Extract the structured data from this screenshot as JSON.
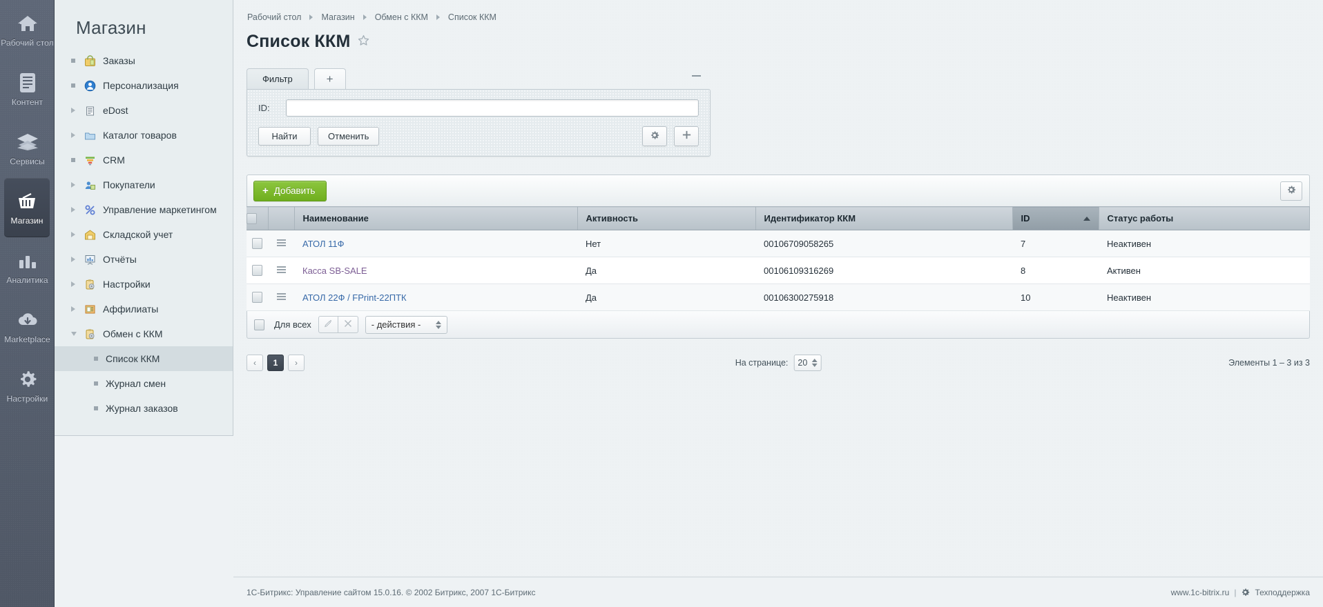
{
  "rail": {
    "items": [
      {
        "label": "Рабочий стол",
        "icon": "home-icon",
        "active": false
      },
      {
        "label": "Контент",
        "icon": "document-icon",
        "active": false
      },
      {
        "label": "Сервисы",
        "icon": "layers-icon",
        "active": false
      },
      {
        "label": "Магазин",
        "icon": "basket-icon",
        "active": true
      },
      {
        "label": "Аналитика",
        "icon": "bar-chart-icon",
        "active": false
      },
      {
        "label": "Marketplace",
        "icon": "cloud-download-icon",
        "active": false
      },
      {
        "label": "Настройки",
        "icon": "gear-icon",
        "active": false
      }
    ]
  },
  "sidebar": {
    "title": "Магазин",
    "items": [
      {
        "label": "Заказы",
        "marker": "square",
        "icon": "orders-icon"
      },
      {
        "label": "Персонализация",
        "marker": "square",
        "icon": "personalization-icon"
      },
      {
        "label": "eDost",
        "marker": "triangle",
        "icon": "edost-icon"
      },
      {
        "label": "Каталог товаров",
        "marker": "triangle",
        "icon": "folder-icon"
      },
      {
        "label": "CRM",
        "marker": "square",
        "icon": "crm-funnel-icon"
      },
      {
        "label": "Покупатели",
        "marker": "triangle",
        "icon": "customers-icon"
      },
      {
        "label": "Управление маркетингом",
        "marker": "triangle",
        "icon": "percent-icon"
      },
      {
        "label": "Складской учет",
        "marker": "triangle",
        "icon": "warehouse-icon"
      },
      {
        "label": "Отчёты",
        "marker": "triangle",
        "icon": "reports-icon"
      },
      {
        "label": "Настройки",
        "marker": "triangle",
        "icon": "settings-clipboard-icon"
      },
      {
        "label": "Аффилиаты",
        "marker": "triangle",
        "icon": "affiliates-icon"
      },
      {
        "label": "Обмен с ККМ",
        "marker": "triangle-down",
        "icon": "kkm-exchange-icon"
      }
    ],
    "subitems": [
      {
        "label": "Список ККМ",
        "selected": true
      },
      {
        "label": "Журнал смен",
        "selected": false
      },
      {
        "label": "Журнал заказов",
        "selected": false
      }
    ]
  },
  "breadcrumb": {
    "items": [
      "Рабочий стол",
      "Магазин",
      "Обмен с ККМ",
      "Список ККМ"
    ]
  },
  "page": {
    "title": "Список ККМ",
    "favorite_icon": "star-outline-icon"
  },
  "filter": {
    "tab_label": "Фильтр",
    "add_tab_label": "+",
    "collapse_label": "—",
    "id_label": "ID:",
    "id_value": "",
    "id_placeholder": "",
    "search_label": "Найти",
    "cancel_label": "Отменить",
    "settings_icon": "gear-icon",
    "add_icon": "plus-icon"
  },
  "toolbar": {
    "add_label": "Добавить",
    "add_plus": "+",
    "settings_icon": "gear-icon"
  },
  "grid": {
    "columns": [
      {
        "key": "check",
        "label": ""
      },
      {
        "key": "menu",
        "label": ""
      },
      {
        "key": "name",
        "label": "Наименование"
      },
      {
        "key": "activity",
        "label": "Активность"
      },
      {
        "key": "kkm_id",
        "label": "Идентификатор ККМ"
      },
      {
        "key": "id",
        "label": "ID",
        "sorted": true,
        "sort_dir": "asc"
      },
      {
        "key": "status",
        "label": "Статус работы"
      }
    ],
    "rows": [
      {
        "name": "АТОЛ 11Ф",
        "visited": false,
        "activity": "Нет",
        "kkm_id": "00106709058265",
        "id": "7",
        "status": "Неактивен"
      },
      {
        "name": "Касса SB-SALE",
        "visited": true,
        "activity": "Да",
        "kkm_id": "00106109316269",
        "id": "8",
        "status": "Активен"
      },
      {
        "name": "АТОЛ 22Ф / FPrint-22ПТК",
        "visited": false,
        "activity": "Да",
        "kkm_id": "00106300275918",
        "id": "10",
        "status": "Неактивен"
      }
    ]
  },
  "group_actions": {
    "select_all_label": "Для всех",
    "edit_icon": "pencil-icon",
    "delete_icon": "close-x-icon",
    "action_select_value": "- действия -"
  },
  "pager": {
    "prev_label": "‹",
    "next_label": "›",
    "pages": [
      "1"
    ],
    "current_page": "1",
    "per_page_label": "На странице:",
    "per_page_value": "20",
    "count_text": "Элементы 1 – 3 из 3"
  },
  "footer": {
    "copyright": "1С-Битрикс: Управление сайтом 15.0.16. © 2002 Битрикс, 2007 1С-Битрикс",
    "site_link": "www.1c-bitrix.ru",
    "separator": "|",
    "support_link": "Техподдержка",
    "support_icon": "gear-icon"
  },
  "colors": {
    "rail_bg": "#565f6e",
    "sidebar_bg": "#e8eef0",
    "workarea_bg": "#eef2f4",
    "add_button_green": "#7cb82f",
    "link_blue": "#3769a8",
    "link_visited": "#7c5d94",
    "header_grey": "#b8c2c9",
    "sorted_header": "#919da6"
  }
}
